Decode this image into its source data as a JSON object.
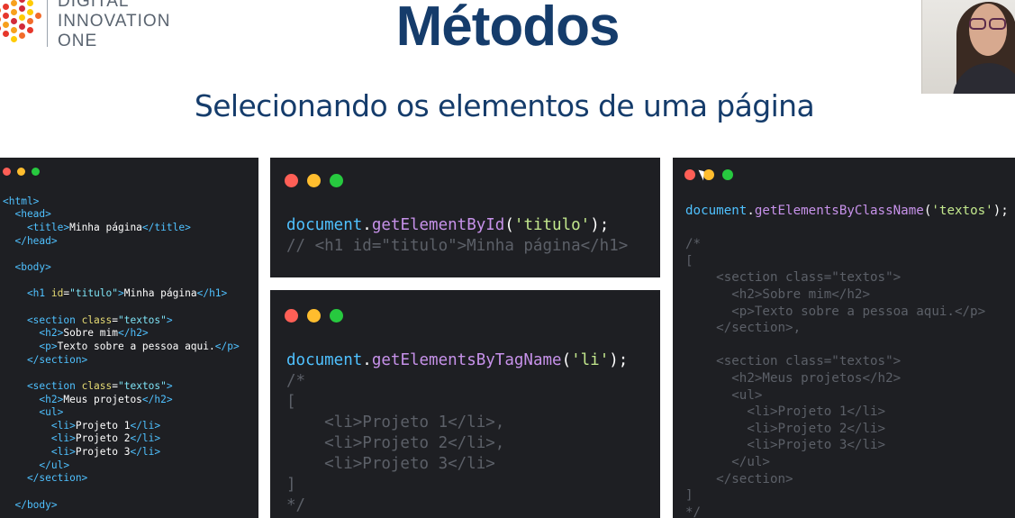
{
  "logo": {
    "lines": [
      "DIGITAL",
      "INNOVATION",
      "ONE"
    ]
  },
  "title": "Métodos",
  "subtitle": "Selecionando os elementos de uma página",
  "colors": {
    "title": "#153c6b",
    "panel_bg": "#1e1f23",
    "red_light": "#ff5f56",
    "yellow_light": "#ffbd2e",
    "green_light": "#27c93f"
  },
  "panel_left": {
    "lines": [
      [],
      [
        "<html>"
      ],
      [
        "  <head>"
      ],
      [
        "    <title>",
        "Minha página",
        "</title>"
      ],
      [
        "  </head>"
      ],
      [],
      [
        "  <body>"
      ],
      [],
      [
        "    <h1 ",
        "id",
        "=",
        "\"titulo\"",
        ">",
        "Minha página",
        "</h1>"
      ],
      [],
      [
        "    <section ",
        "class",
        "=",
        "\"textos\"",
        ">"
      ],
      [
        "      <h2>",
        "Sobre mim",
        "</h2>"
      ],
      [
        "      <p>",
        "Texto sobre a pessoa aqui.",
        "</p>"
      ],
      [
        "    </section>"
      ],
      [],
      [
        "    <section ",
        "class",
        "=",
        "\"textos\"",
        ">"
      ],
      [
        "      <h2>",
        "Meus projetos",
        "</h2>"
      ],
      [
        "      <ul>"
      ],
      [
        "        <li>",
        "Projeto 1",
        "</li>"
      ],
      [
        "        <li>",
        "Projeto 2",
        "</li>"
      ],
      [
        "        <li>",
        "Projeto 3",
        "</li>"
      ],
      [
        "      </ul>"
      ],
      [
        "    </section>"
      ],
      [],
      [
        "  </body>"
      ]
    ]
  },
  "panel_mid_top": {
    "line1": [
      "document",
      ".",
      "getElementById",
      "(",
      "'titulo'",
      ");"
    ],
    "line2": "// <h1 id=\"titulo\">Minha página</h1>"
  },
  "panel_mid_bottom": {
    "line1": [
      "document",
      ".",
      "getElementsByTagName",
      "(",
      "'li'",
      ");"
    ],
    "comment": [
      "/*",
      "[",
      "    <li>Projeto 1</li>,",
      "    <li>Projeto 2</li>,",
      "    <li>Projeto 3</li>",
      "]",
      "*/"
    ]
  },
  "panel_right": {
    "line1": [
      "document",
      ".",
      "getElementsByClassName",
      "(",
      "'textos'",
      ");"
    ],
    "comment": [
      "/*",
      "[",
      "    <section class=\"textos\">",
      "      <h2>Sobre mim</h2>",
      "      <p>Texto sobre a pessoa aqui.</p>",
      "    </section>,",
      "",
      "    <section class=\"textos\">",
      "      <h2>Meus projetos</h2>",
      "      <ul>",
      "        <li>Projeto 1</li>",
      "        <li>Projeto 2</li>",
      "        <li>Projeto 3</li>",
      "      </ul>",
      "    </section>",
      "]",
      "*/"
    ]
  }
}
